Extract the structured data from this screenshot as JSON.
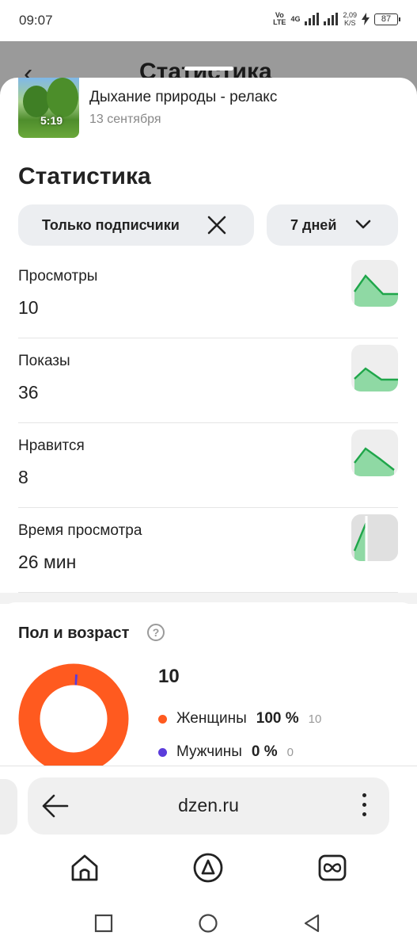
{
  "status_bar": {
    "time": "09:07",
    "network_top": "Vo",
    "network_bottom": "LTE",
    "gen": "4G",
    "speed_top": "2,09",
    "speed_bottom": "K/S",
    "battery": "87"
  },
  "background_page": {
    "title": "Статистика"
  },
  "video": {
    "duration": "5:19",
    "title": "Дыхание природы - релакс",
    "date": "13 сентября"
  },
  "stats": {
    "title": "Статистика",
    "filter_chip": "Только подписчики",
    "period_chip": "7 дней",
    "metrics": [
      {
        "label": "Просмотры",
        "value": "10"
      },
      {
        "label": "Показы",
        "value": "36"
      },
      {
        "label": "Нравится",
        "value": "8"
      },
      {
        "label": "Время просмотра",
        "value": "26 мин"
      }
    ]
  },
  "gender_age": {
    "title": "Пол и возраст",
    "help_icon": "?",
    "total": "10",
    "rows": [
      {
        "label": "Женщины",
        "percent": "100 %",
        "count": "10",
        "color": "#ff5a1f"
      },
      {
        "label": "Мужчины",
        "percent": "0 %",
        "count": "0",
        "color": "#5b3cdb"
      }
    ]
  },
  "browser": {
    "url": "dzen.ru",
    "back_icon": "arrow-left-icon",
    "menu_icon": "more-vertical-icon"
  },
  "bottom_nav": {
    "home_icon": "home-icon",
    "alice_icon": "alice-icon",
    "tabs_icon": "tabs-icon"
  },
  "colors": {
    "accent_green": "#22b04b",
    "chart_fill": "#8fd9a4",
    "chip_bg": "#eceef1"
  }
}
